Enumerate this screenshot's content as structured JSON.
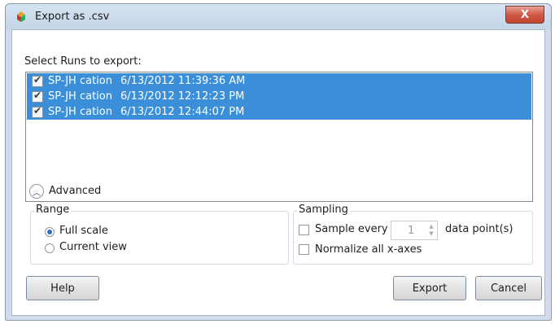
{
  "window": {
    "title": "Export as .csv",
    "close_glyph": "X"
  },
  "runs": {
    "label": "Select Runs to export:",
    "items": [
      {
        "name": "SP-JH cation",
        "date": "6/13/2012 11:39:36 AM",
        "checked": true
      },
      {
        "name": "SP-JH cation",
        "date": "6/13/2012 12:12:23 PM",
        "checked": true
      },
      {
        "name": "SP-JH cation",
        "date": "6/13/2012 12:44:07 PM",
        "checked": true
      }
    ]
  },
  "advanced": {
    "label": "Advanced",
    "icon": "chevron-up-icon"
  },
  "range": {
    "title": "Range",
    "options": [
      {
        "label": "Full scale",
        "selected": true
      },
      {
        "label": "Current view",
        "selected": false
      }
    ]
  },
  "sampling": {
    "title": "Sampling",
    "sample_every_label": "Sample every",
    "sample_every_value": "1",
    "sample_every_suffix": "data point(s)",
    "sample_every_checked": false,
    "normalize_label": "Normalize all x-axes",
    "normalize_checked": false
  },
  "buttons": {
    "help": "Help",
    "export": "Export",
    "cancel": "Cancel"
  },
  "colors": {
    "selection": "#3a8fd8",
    "title_bar": "#c5d6e8",
    "close_button": "#cf5a46"
  }
}
